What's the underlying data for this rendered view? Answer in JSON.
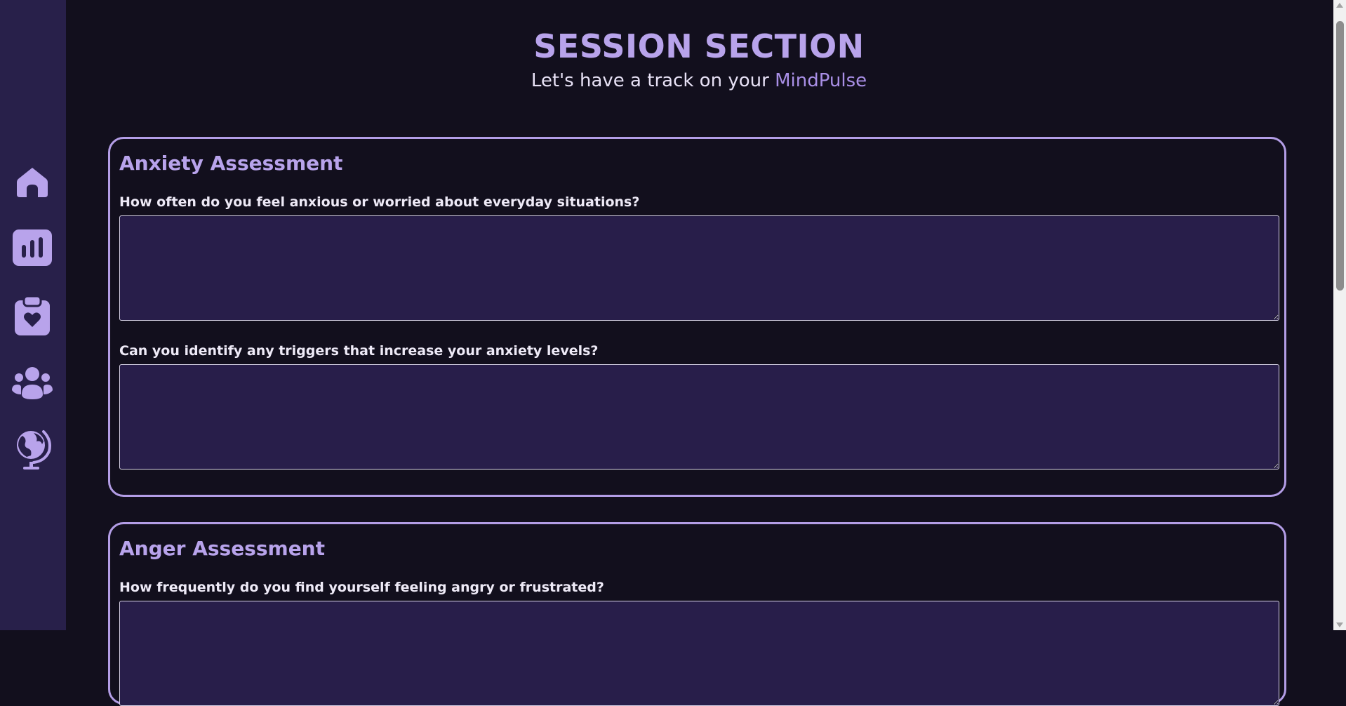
{
  "header": {
    "title": "SESSION SECTION",
    "subtitle_prefix": "Let's have a track on your ",
    "brand": "MindPulse"
  },
  "sidebar": {
    "items": [
      {
        "icon": "home-icon",
        "label": "Home"
      },
      {
        "icon": "bar-chart-icon",
        "label": "Dashboard"
      },
      {
        "icon": "clipboard-heart-icon",
        "label": "Session"
      },
      {
        "icon": "community-icon",
        "label": "Community"
      },
      {
        "icon": "globe-icon",
        "label": "Explore"
      }
    ],
    "accent": "#b39de6"
  },
  "sections": [
    {
      "title": "Anxiety Assessment",
      "questions": [
        {
          "label": "How often do you feel anxious or worried about everyday situations?",
          "value": ""
        },
        {
          "label": "Can you identify any triggers that increase your anxiety levels?",
          "value": ""
        }
      ]
    },
    {
      "title": "Anger Assessment",
      "questions": [
        {
          "label": "How frequently do you find yourself feeling angry or frustrated?",
          "value": ""
        }
      ]
    }
  ],
  "colors": {
    "background": "#120f1d",
    "sidebar": "#28204a",
    "accent": "#b8a3eb",
    "field": "#281e4a"
  }
}
